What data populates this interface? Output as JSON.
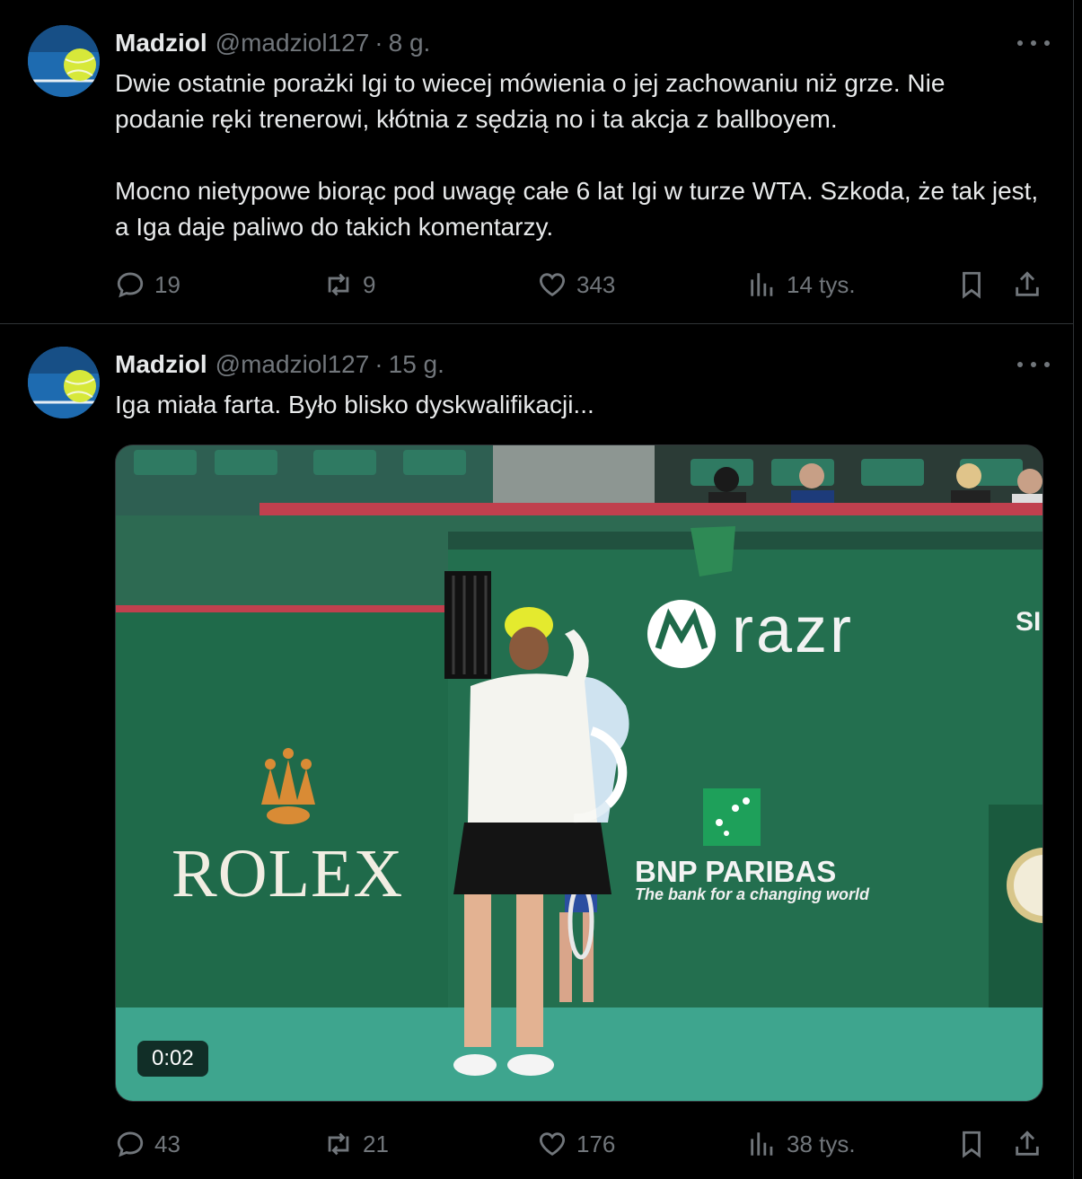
{
  "tweets": [
    {
      "author": {
        "name": "Madziol",
        "handle": "@madziol127",
        "avatar": "tennis-ball-avatar"
      },
      "separator": "·",
      "time": "8 g.",
      "text": "Dwie ostatnie porażki Igi to wiecej mówienia o jej zachowaniu niż grze. Nie podanie ręki trenerowi, kłótnia z sędzią no i ta akcja z ballboyem.\n\nMocno nietypowe biorąc pod uwagę całe 6 lat Igi w turze WTA. Szkoda, że tak jest, a Iga daje paliwo do takich komentarzy.",
      "stats": {
        "replies": "19",
        "reposts": "9",
        "likes": "343",
        "views": "14 tys."
      }
    },
    {
      "author": {
        "name": "Madziol",
        "handle": "@madziol127",
        "avatar": "tennis-ball-avatar"
      },
      "separator": "·",
      "time": "15 g.",
      "text": "Iga miała farta. Było blisko dyskwalifikacji...",
      "media": {
        "type": "video",
        "duration": "0:02",
        "signage": {
          "rolex": "ROLEX",
          "razr": "razr",
          "bnp_name": "BNP PARIBAS",
          "bnp_tagline": "The bank for a changing world",
          "partial_sign": "SI"
        }
      },
      "stats": {
        "replies": "43",
        "reposts": "21",
        "likes": "176",
        "views": "38 tys."
      }
    }
  ],
  "icons": {
    "reply": "speech-bubble-icon",
    "repost": "repost-arrows-icon",
    "like": "heart-icon",
    "views": "bar-chart-icon",
    "bookmark": "bookmark-icon",
    "share": "share-upload-icon",
    "more": "more-dots-icon"
  },
  "colors": {
    "background": "#000000",
    "text": "#e7e9ea",
    "muted": "#71767b",
    "border": "#2f3336"
  }
}
